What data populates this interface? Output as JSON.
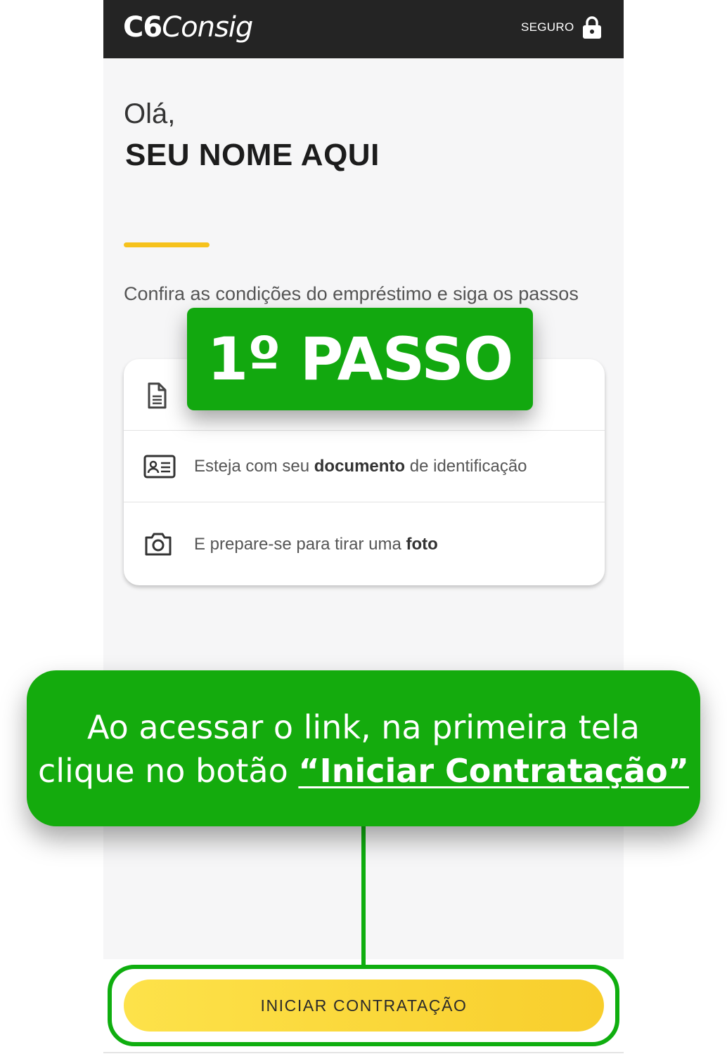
{
  "header": {
    "logo_c6": "C6",
    "logo_product": "Consig",
    "secure_label": "SEGURO",
    "secure_icon": "lock-icon"
  },
  "greeting": {
    "hello": "Olá,",
    "name": "SEU NOME AQUI"
  },
  "intro": {
    "text": "Confira as condições do empréstimo e siga os passos"
  },
  "steps_card": {
    "rows": [
      {
        "icon": "document-icon",
        "pre": "",
        "bold": "",
        "post": ""
      },
      {
        "icon": "id-card-icon",
        "pre": "Esteja com seu ",
        "bold": "documento",
        "post": " de identificação"
      },
      {
        "icon": "camera-icon",
        "pre": "E prepare-se para tirar uma ",
        "bold": "foto",
        "post": ""
      }
    ]
  },
  "annotation": {
    "step_badge": "1º PASSO",
    "callout_line1": "Ao acessar o link, na primeira tela",
    "callout_line2_pre": "clique no botão ",
    "callout_line2_highlight": "“Iniciar Contratação”"
  },
  "cta": {
    "label": "INICIAR CONTRATAÇÃO"
  },
  "colors": {
    "header_bg": "#242424",
    "accent_yellow": "#f6c21c",
    "annotation_green": "#12a80f",
    "cta_yellow": "#fde24a"
  }
}
